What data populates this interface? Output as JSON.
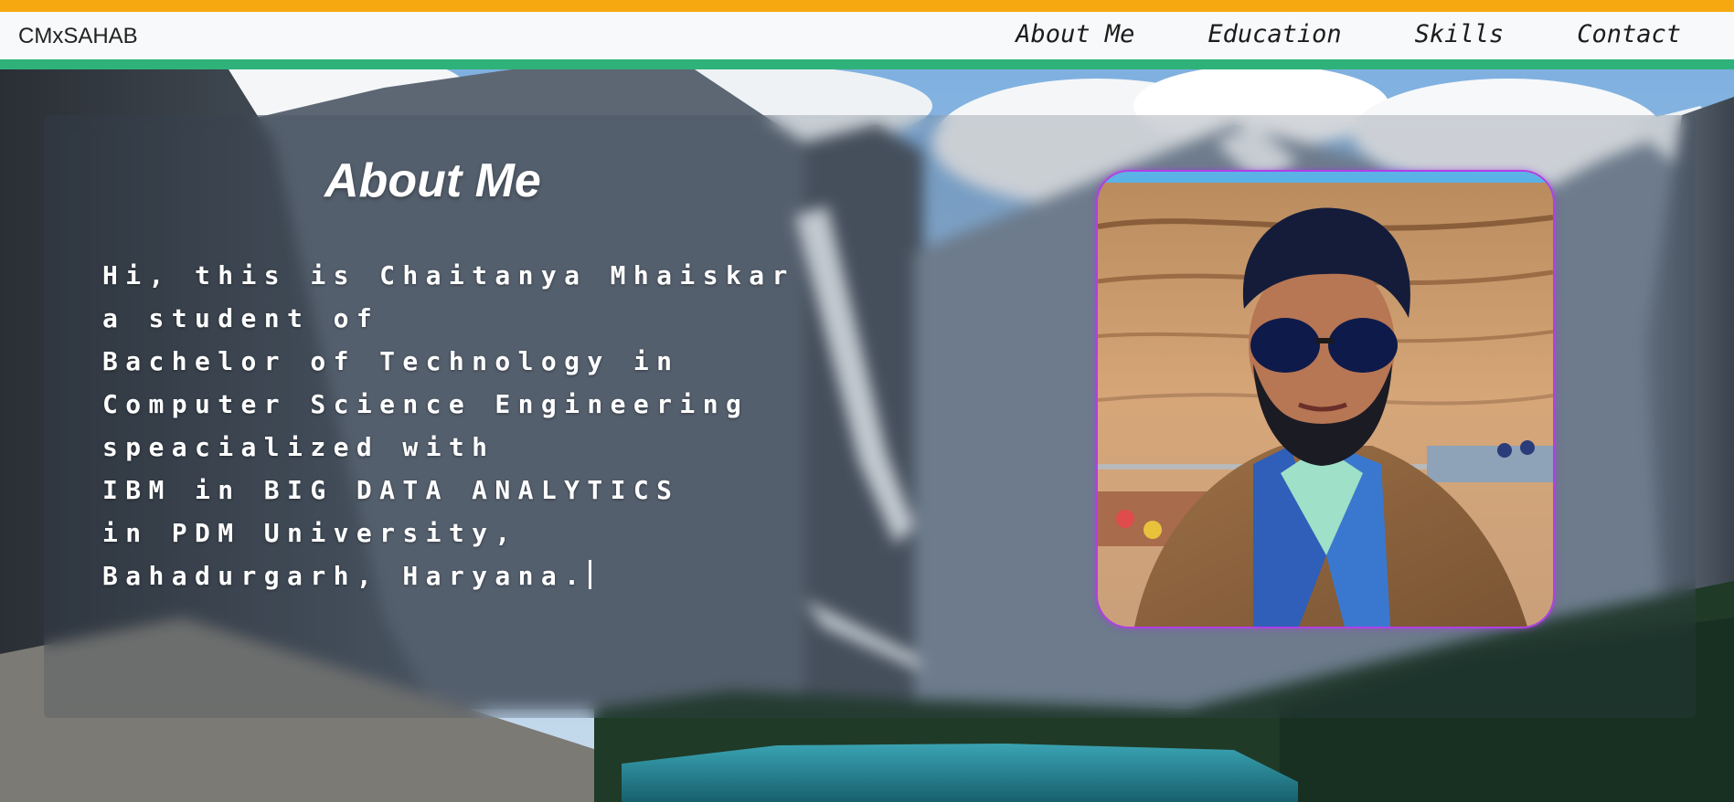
{
  "navbar": {
    "brand": "CMxSAHAB",
    "links": [
      {
        "label": "About Me"
      },
      {
        "label": "Education"
      },
      {
        "label": "Skills"
      },
      {
        "label": "Contact"
      }
    ]
  },
  "about": {
    "title": "About Me",
    "lines": [
      "Hi, this is Chaitanya Mhaiskar",
      "a student of",
      "Bachelor of Technology in",
      "Computer Science Engineering",
      "speacialized with",
      "IBM in BIG DATA ANALYTICS",
      "in PDM University,",
      "Bahadurgarh, Haryana."
    ]
  },
  "colors": {
    "top_stripe": "#f5a80f",
    "bottom_stripe": "#2fb27a",
    "navbar_bg": "#f8f9fa",
    "photo_border": "#b140e6"
  },
  "icons": {
    "text_cursor": "text-cursor-icon"
  }
}
